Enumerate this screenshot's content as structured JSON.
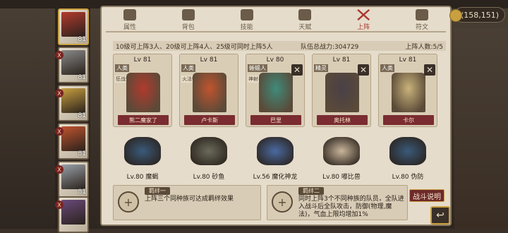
{
  "currency": {
    "value": "(158,151)"
  },
  "tabs": [
    {
      "label": "属性",
      "icon": "flame-icon",
      "active": false
    },
    {
      "label": "背包",
      "icon": "helmet-icon",
      "active": false
    },
    {
      "label": "技能",
      "icon": "book-icon",
      "active": false
    },
    {
      "label": "天赋",
      "icon": "bookshelf-icon",
      "active": false
    },
    {
      "label": "上阵",
      "icon": "crossed-swords-icon",
      "active": true
    },
    {
      "label": "符文",
      "icon": "rune-icon",
      "active": false
    }
  ],
  "formation": {
    "rule": "10级可上阵3人、20级可上阵4人、25级可同时上阵5人",
    "power_label": "队伍总战力:",
    "power_value": "304729",
    "count_label": "上阵人数:",
    "count_value": "5/5"
  },
  "heroes": [
    {
      "level": "Lv 81",
      "race": "人类",
      "tag": "狂战士",
      "name": "熊二魔家了",
      "removable": false,
      "color": "#b03a2e"
    },
    {
      "level": "Lv 81",
      "race": "人类",
      "tag": "火法师",
      "name": "卢卡斯",
      "removable": false,
      "color": "#c0542e"
    },
    {
      "level": "Lv 80",
      "race": "蜥蜴人",
      "tag": "神射手",
      "name": "巴里",
      "removable": true,
      "color": "#3f8a7a"
    },
    {
      "level": "Lv 81",
      "race": "精灵",
      "tag": "",
      "name": "奥托林",
      "removable": true,
      "color": "#4a4048"
    },
    {
      "level": "Lv 81",
      "race": "人类",
      "tag": "",
      "name": "卡尔",
      "removable": true,
      "color": "#c9b27a"
    }
  ],
  "pets": [
    {
      "label": "Lv.80 魔蝎",
      "color": "#3a5a7a"
    },
    {
      "label": "Lv.80 砂鱼",
      "color": "#6a6a5a"
    },
    {
      "label": "Lv.56 魔化神龙",
      "color": "#4a6aa0"
    },
    {
      "label": "Lv.80 嘟比兽",
      "color": "#c9b59a"
    },
    {
      "label": "Lv.80 伪防",
      "color": "#3a5a7a"
    }
  ],
  "bonds": [
    {
      "title": "羁绊一",
      "desc": "上阵三个同种族可达成羁绊效果"
    },
    {
      "title": "羁绊二",
      "desc": "同时上阵3个不同种族的队员，全队进入战斗后全队攻击，防御(物理,魔法)，气血上限均增加1%"
    }
  ],
  "roster": [
    {
      "level": "81",
      "badge": "",
      "color": "#b33a2e",
      "selected": true
    },
    {
      "level": "81",
      "badge": "X",
      "color": "#8a8a8a",
      "selected": false
    },
    {
      "level": "81",
      "badge": "X",
      "color": "#c9a040",
      "selected": false
    },
    {
      "level": "81",
      "badge": "X",
      "color": "#c0542e",
      "selected": false
    },
    {
      "level": "81",
      "badge": "X",
      "color": "#9aa0a8",
      "selected": false
    },
    {
      "level": "",
      "badge": "X",
      "color": "#6a4a7a",
      "selected": false
    }
  ],
  "buttons": {
    "fight_info": "战斗说明",
    "back": "↩"
  }
}
